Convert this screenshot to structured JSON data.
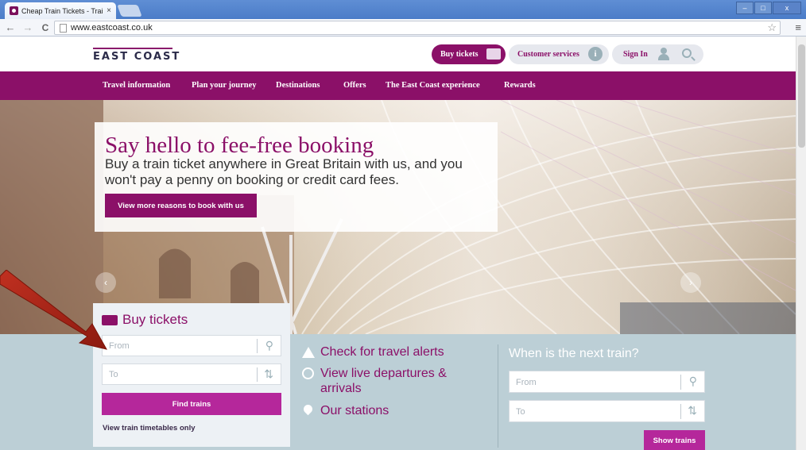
{
  "browser": {
    "tab_title": "Cheap Train Tickets - Train T",
    "tab_close": "×",
    "url": "www.eastcoast.co.uk",
    "back_glyph": "←",
    "forward_glyph": "→",
    "reload_glyph": "C",
    "star_glyph": "☆",
    "menu_glyph": "≡",
    "window_minimize": "–",
    "window_maximize": "□",
    "window_close": "x"
  },
  "header": {
    "logo": "EAST COAST",
    "buy_tickets": "Buy tickets",
    "customer_services": "Customer services",
    "sign_in": "Sign In",
    "info_glyph": "i"
  },
  "nav": {
    "items": [
      {
        "label": "Travel information"
      },
      {
        "label": "Plan your journey"
      },
      {
        "label": "Destinations"
      },
      {
        "label": "Offers"
      },
      {
        "label": "The East Coast experience"
      },
      {
        "label": "Rewards"
      }
    ]
  },
  "hero": {
    "title": "Say hello to fee-free booking",
    "text": "Buy a train ticket anywhere in Great Britain with us, and you won't pay a penny on booking or credit card fees.",
    "button": "View more reasons to book with us",
    "prev_glyph": "‹",
    "next_glyph": "›"
  },
  "buy_panel": {
    "title": "Buy tickets",
    "from_placeholder": "From",
    "to_placeholder": "To",
    "find_button": "Find trains",
    "timetable_link": "View train timetables only",
    "pin_glyph": "⚲",
    "swap_glyph": "⇅"
  },
  "links": {
    "travel_alerts": "Check for travel alerts",
    "live_departures": "View live departures & arrivals",
    "stations": "Our stations"
  },
  "next_train": {
    "title": "When is the next train?",
    "from_placeholder": "From",
    "to_placeholder": "To",
    "show_button": "Show trains"
  },
  "colors": {
    "brand": "#8b1068",
    "button": "#b5279b",
    "band": "#bccfd6"
  }
}
